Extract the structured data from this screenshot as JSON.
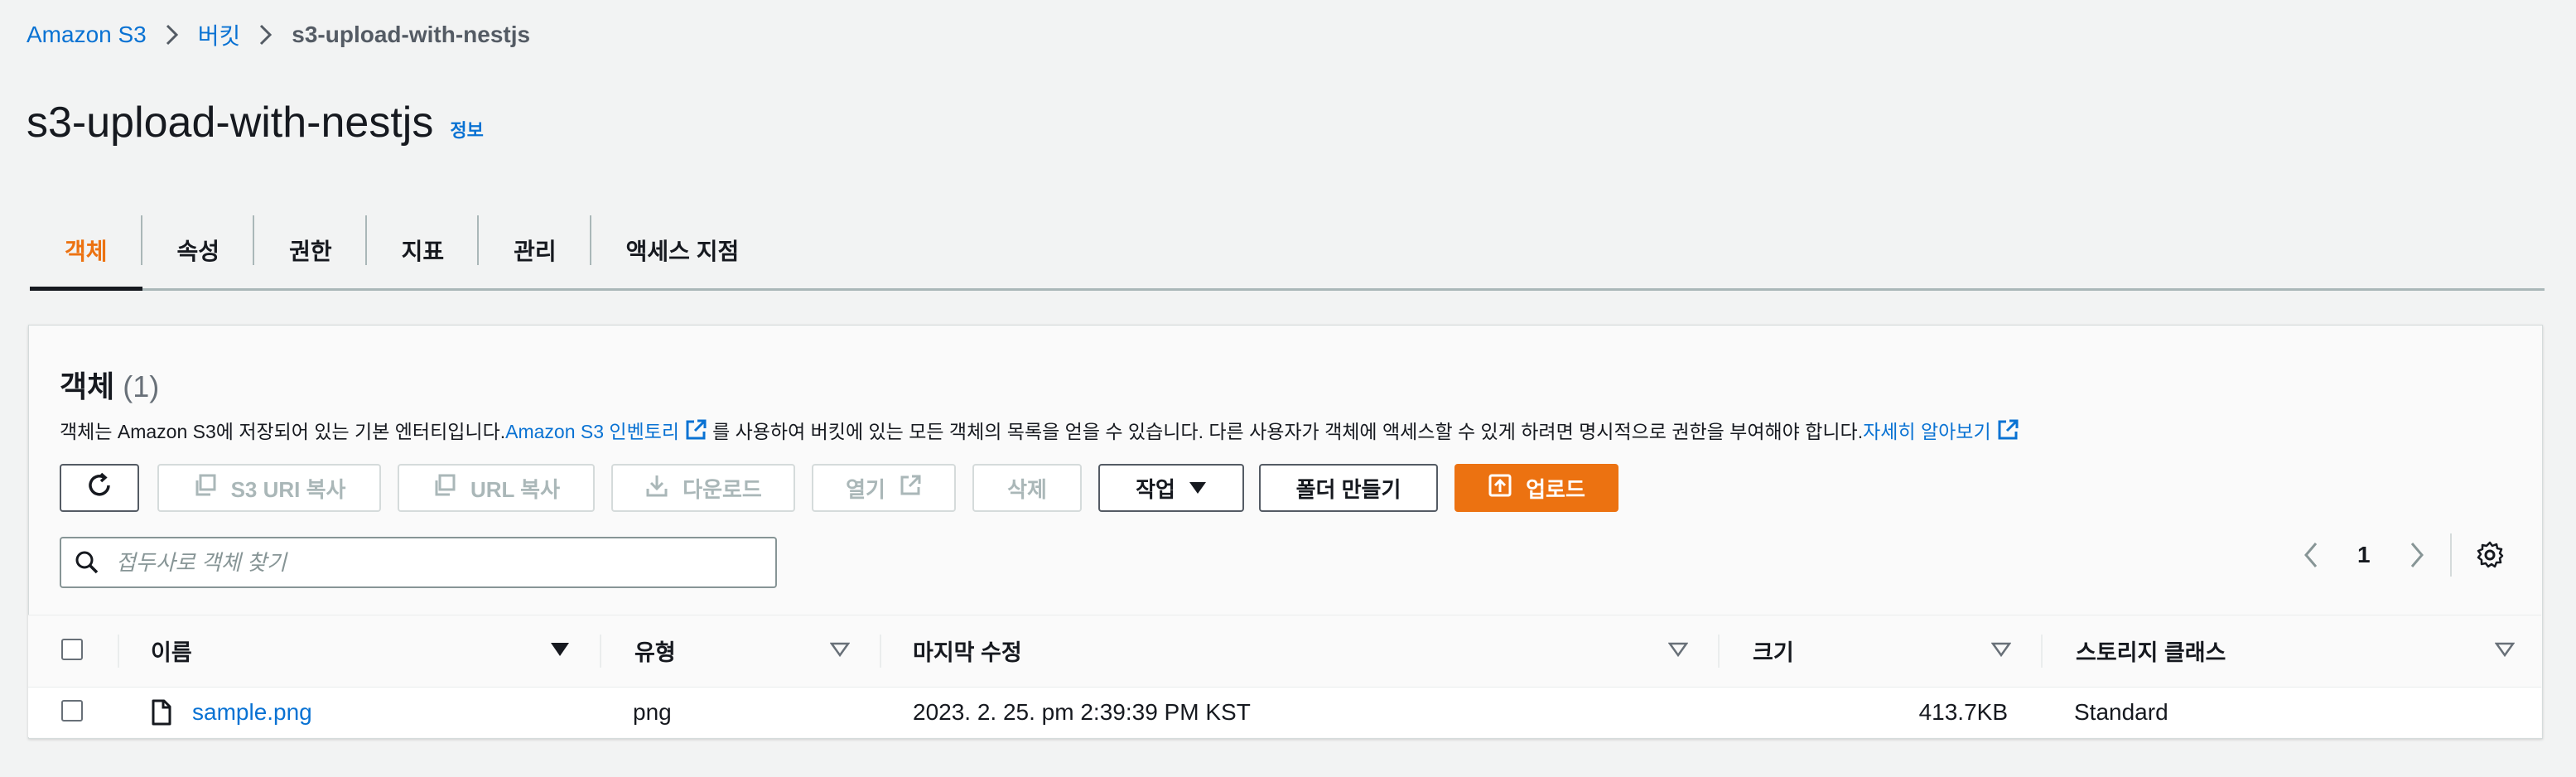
{
  "breadcrumb": {
    "items": [
      "Amazon S3",
      "버킷",
      "s3-upload-with-nestjs"
    ]
  },
  "page": {
    "title": "s3-upload-with-nestjs",
    "info_link": "정보"
  },
  "tabs": [
    {
      "label": "객체",
      "active": true
    },
    {
      "label": "속성"
    },
    {
      "label": "권한"
    },
    {
      "label": "지표"
    },
    {
      "label": "관리"
    },
    {
      "label": "액세스 지점"
    }
  ],
  "objects_panel": {
    "title": "객체",
    "count": "(1)",
    "description_1": "객체는 Amazon S3에 저장되어 있는 기본 엔터티입니다. ",
    "inventory_link": "Amazon S3 인벤토리",
    "description_2": "를 사용하여 버킷에 있는 모든 객체의 목록을 얻을 수 있습니다. 다른 사용자가 객체에 액세스할 수 있게 하려면 명시적으로 권한을 부여해야 합니다. ",
    "learn_more_link": "자세히 알아보기"
  },
  "toolbar": {
    "copy_s3_uri": "S3 URI 복사",
    "copy_url": "URL 복사",
    "download": "다운로드",
    "open": "열기",
    "delete": "삭제",
    "actions": "작업",
    "create_folder": "폴더 만들기",
    "upload": "업로드"
  },
  "search": {
    "placeholder": "접두사로 객체 찾기"
  },
  "pagination": {
    "current_page": "1"
  },
  "table": {
    "columns": [
      "이름",
      "유형",
      "마지막 수정",
      "크기",
      "스토리지 클래스"
    ],
    "rows": [
      {
        "name": "sample.png",
        "type": "png",
        "last_modified": "2023. 2. 25. pm 2:39:39 PM KST",
        "size": "413.7KB",
        "storage_class": "Standard"
      }
    ]
  },
  "colors": {
    "accent": "#ec7211",
    "link": "#0972d3",
    "text": "#16191f",
    "background": "#f2f3f3"
  },
  "icons": [
    "chevron-right-icon",
    "external-link-icon",
    "refresh-icon",
    "copy-icon",
    "download-icon",
    "caret-down-icon",
    "upload-icon",
    "search-icon",
    "chevron-left-icon",
    "settings-icon",
    "file-icon",
    "sort-icon"
  ]
}
